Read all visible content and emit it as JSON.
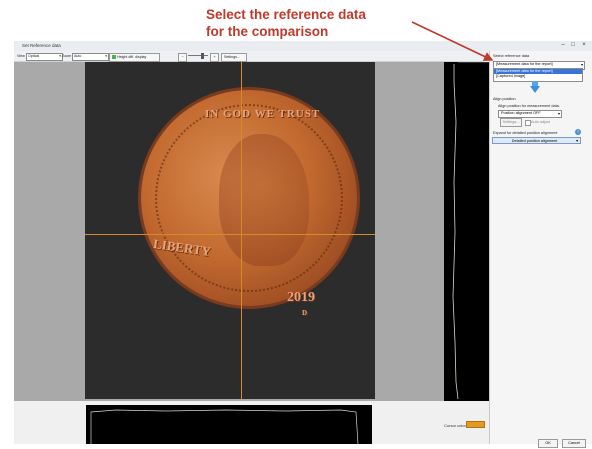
{
  "annotation": {
    "line1": "Select the reference data",
    "line2": "for the comparison"
  },
  "window": {
    "title": "Set Reference data",
    "minimize_icon": "minimize-icon",
    "maximize_icon": "maximize-icon",
    "close_icon": "close-icon"
  },
  "toolbar": {
    "view_label": "View",
    "view_value": "Optical",
    "zoom_label": "Zoom",
    "zoom_value": "Auto",
    "height_diff_label": "Height diff. display",
    "settings_label": "Settings..."
  },
  "coin": {
    "motto": "LIBERTY",
    "year": "2019",
    "top_text": "IN GOD WE TRUST",
    "mint": "D"
  },
  "status": {
    "cursor_color_label": "Cursor color"
  },
  "right_panel": {
    "select_reference_label": "Select reference data",
    "combo_value": "[Measurement data for the report]",
    "dropdown_options": [
      "[Measurement data for the report]",
      "[Captured Image]"
    ],
    "align_position_label": "Align position",
    "align_desc": "Align position for measurement data.",
    "position_alignment_value": "Position alignment OFF",
    "settings_button": "Settings...",
    "auto_adjust_label": "Auto adjust",
    "expand_label": "Expand for detailed position alignment",
    "detailed_alignment_button": "Detailed position alignment",
    "ok_button": "OK",
    "cancel_button": "Cancel"
  },
  "colors": {
    "annotation": "#c0392b",
    "crosshair": "#d68a2e",
    "selection": "#3875d7",
    "cursor_swatch": "#e39a1e"
  }
}
